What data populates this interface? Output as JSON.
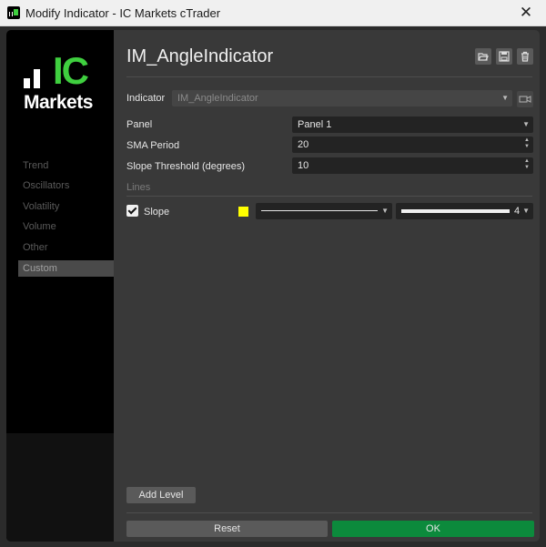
{
  "window": {
    "title": "Modify Indicator - IC Markets cTrader",
    "close_glyph": "✕"
  },
  "logo": {
    "ic": "IC",
    "markets": "Markets",
    "accent_color": "#3fcf3f"
  },
  "categories": [
    {
      "label": "Trend",
      "active": false
    },
    {
      "label": "Oscillators",
      "active": false
    },
    {
      "label": "Volatility",
      "active": false
    },
    {
      "label": "Volume",
      "active": false
    },
    {
      "label": "Other",
      "active": false
    },
    {
      "label": "Custom",
      "active": true
    }
  ],
  "indicator": {
    "name": "IM_AngleIndicator",
    "label": "Indicator",
    "value": "IM_AngleIndicator"
  },
  "toolbar": {
    "icons": [
      "folder-open-icon",
      "save-icon",
      "trash-icon"
    ]
  },
  "params": {
    "panel_label": "Panel",
    "panel_value": "Panel 1",
    "sma_label": "SMA Period",
    "sma_value": "20",
    "slope_label": "Slope Threshold (degrees)",
    "slope_value": "10"
  },
  "lines": {
    "section_label": "Lines",
    "items": [
      {
        "name": "Slope",
        "checked": true,
        "color": "#ffff00",
        "style": "solid",
        "thickness": "4"
      }
    ]
  },
  "buttons": {
    "add_level": "Add Level",
    "reset": "Reset",
    "ok": "OK"
  },
  "colors": {
    "ok_button": "#0c8a3c",
    "panel_bg": "#393939"
  }
}
